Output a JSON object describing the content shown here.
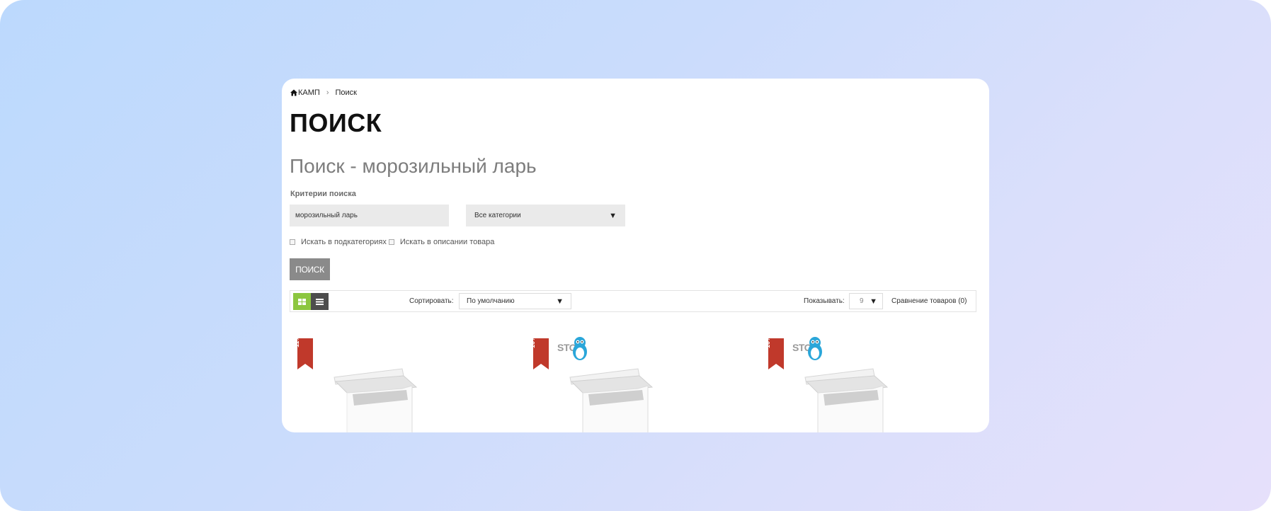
{
  "breadcrumb": {
    "home": "КАМП",
    "current": "Поиск"
  },
  "page_title": "ПОИСК",
  "search_heading": "Поиск - морозильный ларь",
  "criteria_label": "Критерии поиска",
  "search": {
    "value": "морозильный ларь",
    "category": "Все категории",
    "check_subcategories": "Искать в подкатегориях",
    "check_description": "Искать в описании товара",
    "button": "ПОИСК"
  },
  "toolbar": {
    "sort_label": "Сортировать:",
    "sort_value": "По умолчанию",
    "show_label": "Показывать:",
    "show_value": "9",
    "compare": "Сравнение товаров (0)"
  },
  "products": [
    {
      "badge": "-11%",
      "brand": ""
    },
    {
      "badge": "-10%",
      "brand": "STOR"
    },
    {
      "badge": "-10%",
      "brand": "STOR"
    }
  ],
  "colors": {
    "accent_green": "#8cc63f",
    "badge_red": "#c0392b",
    "button_gray": "#8a8a8a",
    "penguin_blue": "#2aa6d9"
  },
  "icons": [
    "home-icon",
    "chevron-right-icon",
    "grid-view-icon",
    "list-view-icon",
    "dropdown-arrow-icon",
    "penguin-logo-icon"
  ]
}
